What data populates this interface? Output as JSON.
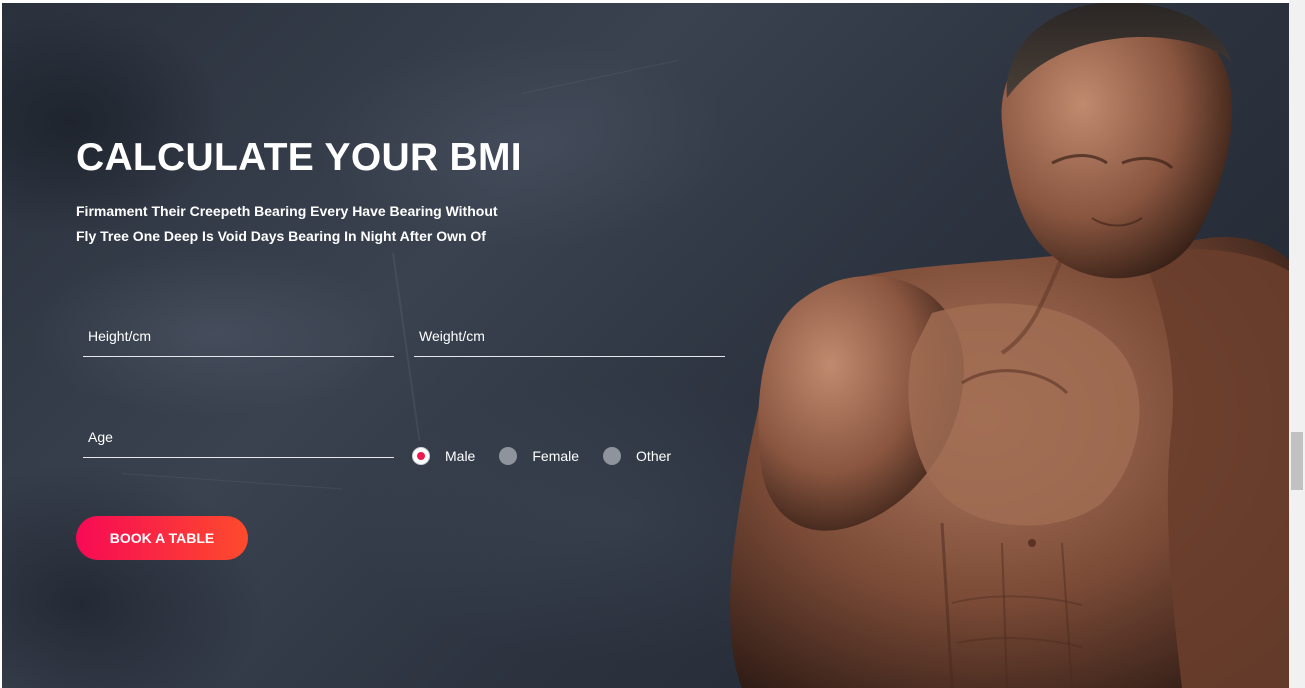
{
  "hero": {
    "title": "CALCULATE YOUR BMI",
    "subtitle_line1": "Firmament Their Creepeth Bearing Every Have Bearing Without",
    "subtitle_line2": "Fly Tree One Deep Is Void Days Bearing In Night After Own Of",
    "image": "muscular-man-photo"
  },
  "form": {
    "height_placeholder": "Height/cm",
    "weight_placeholder": "Weight/cm",
    "age_placeholder": "Age",
    "gender_options": [
      {
        "label": "Male",
        "checked": true
      },
      {
        "label": "Female",
        "checked": false
      },
      {
        "label": "Other",
        "checked": false
      }
    ],
    "submit_label": "BOOK A TABLE"
  },
  "colors": {
    "accent_start": "#f70a55",
    "accent_end": "#fd4b2c",
    "background": "#2f3643",
    "text": "#ffffff"
  }
}
